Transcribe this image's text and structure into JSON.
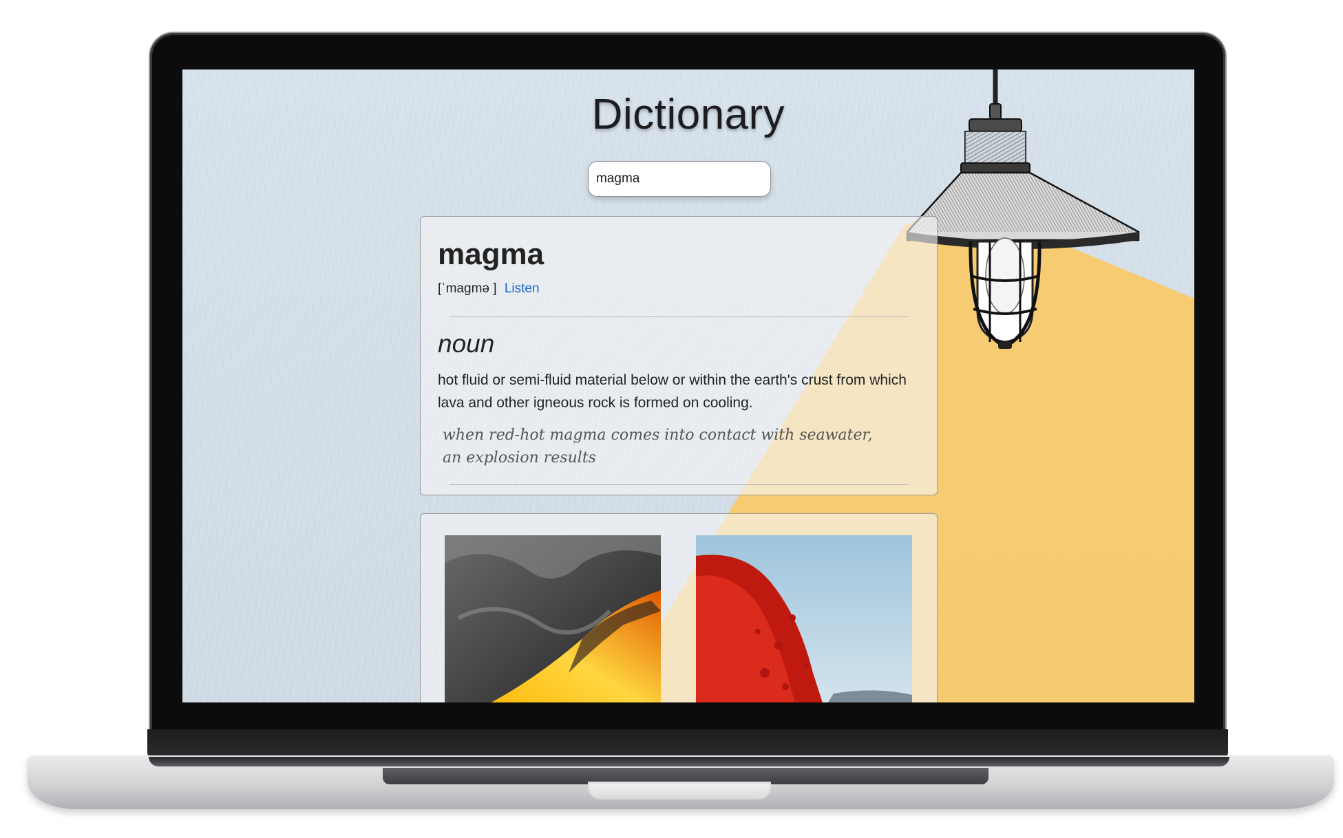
{
  "app": {
    "title": "Dictionary",
    "search": {
      "value": "magma"
    }
  },
  "entry": {
    "word": "magma",
    "phonetic": "[ˈmagmə ]",
    "listen_label": "Listen",
    "part_of_speech": "noun",
    "definition": "hot fluid or semi-fluid material below or within the earth's crust from which lava and other igneous rock is formed on cooling.",
    "example": "when red-hot magma comes into contact with seawater, an explosion results"
  },
  "images": [
    {
      "name": "lava-flow-image"
    },
    {
      "name": "eruption-image"
    }
  ],
  "colors": {
    "wall": "#d2dee8",
    "lamp_light": "#f8c96a",
    "link": "#1a66d2"
  }
}
